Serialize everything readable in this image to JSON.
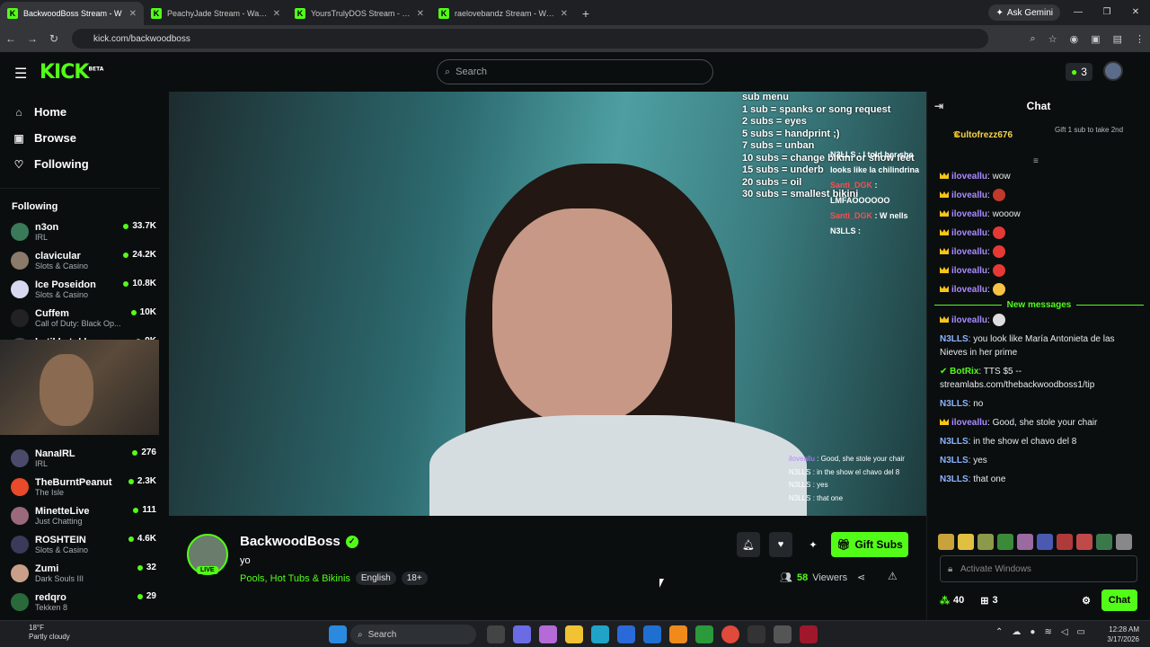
{
  "browser": {
    "tabs": [
      {
        "title": "BackwoodBoss Stream - W",
        "active": true
      },
      {
        "title": "PeachyJade Stream - Watch Live",
        "active": false
      },
      {
        "title": "YoursTrulyDOS Stream - Watch",
        "active": false
      },
      {
        "title": "raelovebandz Stream - Watch L",
        "active": false
      }
    ],
    "gemini": "Ask Gemini",
    "url": "kick.com/backwoodboss"
  },
  "site": {
    "logo": "KICK",
    "logo_badge": "BETA",
    "search_placeholder": "Search",
    "badge_count": "3"
  },
  "sidebar": {
    "nav": [
      {
        "label": "Home",
        "icon": "home-icon"
      },
      {
        "label": "Browse",
        "icon": "browse-icon"
      },
      {
        "label": "Following",
        "icon": "heart-icon"
      }
    ],
    "section": "Following",
    "channels_top": [
      {
        "name": "n3on",
        "category": "IRL",
        "viewers": "33.7K",
        "color": "#3a7a5a"
      },
      {
        "name": "clavicular",
        "category": "Slots & Casino",
        "viewers": "24.2K",
        "color": "#8a7a6a"
      },
      {
        "name": "Ice Poseidon",
        "category": "Slots & Casino",
        "viewers": "10.8K",
        "color": "#d8d8f0"
      },
      {
        "name": "Cuffem",
        "category": "Call of Duty: Black Op...",
        "viewers": "10K",
        "color": "#222"
      },
      {
        "name": "hstikkytokky",
        "category": "Just Chatting",
        "viewers": "9K",
        "color": "#444"
      }
    ],
    "channels_bottom": [
      {
        "name": "NanaIRL",
        "category": "IRL",
        "viewers": "276",
        "color": "#4a4a6a"
      },
      {
        "name": "TheBurntPeanut",
        "category": "The Isle",
        "viewers": "2.3K",
        "color": "#e84a2a"
      },
      {
        "name": "MinetteLive",
        "category": "Just Chatting",
        "viewers": "111",
        "color": "#9a6a7a"
      },
      {
        "name": "ROSHTEIN",
        "category": "Slots & Casino",
        "viewers": "4.6K",
        "color": "#3a3a5a"
      },
      {
        "name": "Zumi",
        "category": "Dark Souls III",
        "viewers": "32",
        "color": "#c8a08a"
      },
      {
        "name": "redqro",
        "category": "Tekken 8",
        "viewers": "29",
        "color": "#2a6a3a"
      }
    ]
  },
  "video": {
    "sub_menu": [
      "sub menu",
      "1 sub = spanks or song request",
      "2 subs = eyes",
      "5 subs = handprint ;)",
      "7 subs = unban",
      "10 subs = change bikini or show feet",
      "15 subs = underb",
      "20 subs = oil",
      "30 subs = smallest bikini"
    ],
    "overlay_chat": [
      {
        "user": "N3LLS",
        "text": "I told her she looks like la chilindrina"
      },
      {
        "user": "Santi_DGK",
        "text": "LMFAOOOOOO"
      },
      {
        "user": "Santi_DGK",
        "text": "W nells"
      },
      {
        "user": "N3LLS",
        "text": ""
      }
    ],
    "overlay_chat2": [
      {
        "user": "iloveallu",
        "text": "Good, she stole your chair"
      },
      {
        "user": "N3LLS",
        "text": "in the show el chavo del 8"
      },
      {
        "user": "N3LLS",
        "text": "yes"
      },
      {
        "user": "N3LLS",
        "text": "that one"
      }
    ]
  },
  "channel": {
    "name": "BackwoodBoss",
    "live": "LIVE",
    "title": "yo",
    "category": "Pools, Hot Tubs & Bikinis",
    "tags": [
      "English",
      "18+"
    ],
    "gift_label": "Gift Subs",
    "viewers": "58",
    "viewers_label": "Viewers"
  },
  "chat": {
    "header": "Chat",
    "pinned_user": "Cultofrezz676",
    "pinned_text": "Gift 1 sub to take 2nd",
    "messages": [
      {
        "user": "iloveallu",
        "text": "wow",
        "color": "purple"
      },
      {
        "user": "iloveallu",
        "text": "",
        "color": "purple",
        "emote": "#c0392b"
      },
      {
        "user": "iloveallu",
        "text": "wooow",
        "color": "purple"
      },
      {
        "user": "iloveallu",
        "text": "",
        "color": "purple",
        "emote": "#e53935"
      },
      {
        "user": "iloveallu",
        "text": "",
        "color": "purple",
        "emote": "#e53935"
      },
      {
        "user": "iloveallu",
        "text": "",
        "color": "purple",
        "emote": "#e53935"
      },
      {
        "user": "iloveallu",
        "text": "",
        "color": "purple",
        "emote": "#f6c343"
      }
    ],
    "new_messages": "New messages",
    "messages_after": [
      {
        "user": "iloveallu",
        "text": "",
        "color": "purple",
        "emote": "#dddddd"
      },
      {
        "user": "N3LLS",
        "text": "you look like María Antonieta de las Nieves in her prime",
        "color": "blue"
      },
      {
        "user": "BotRix",
        "text": "TTS $5 -- streamlabs.com/thebackwoodboss1/tip",
        "color": "green"
      },
      {
        "user": "N3LLS",
        "text": "no",
        "color": "blue"
      },
      {
        "user": "iloveallu",
        "text": "Good, she stole your chair",
        "color": "purple"
      },
      {
        "user": "N3LLS",
        "text": "in the show el chavo del 8",
        "color": "blue"
      },
      {
        "user": "N3LLS",
        "text": "yes",
        "color": "blue"
      },
      {
        "user": "N3LLS",
        "text": "that one",
        "color": "blue"
      }
    ],
    "input_placeholder": "Activate Windows",
    "points": "40",
    "gifts": "3",
    "send": "Chat"
  },
  "taskbar": {
    "temp": "18°F",
    "weather": "Partly cloudy",
    "search": "Search",
    "time": "12:28 AM",
    "date": "3/17/2026"
  }
}
